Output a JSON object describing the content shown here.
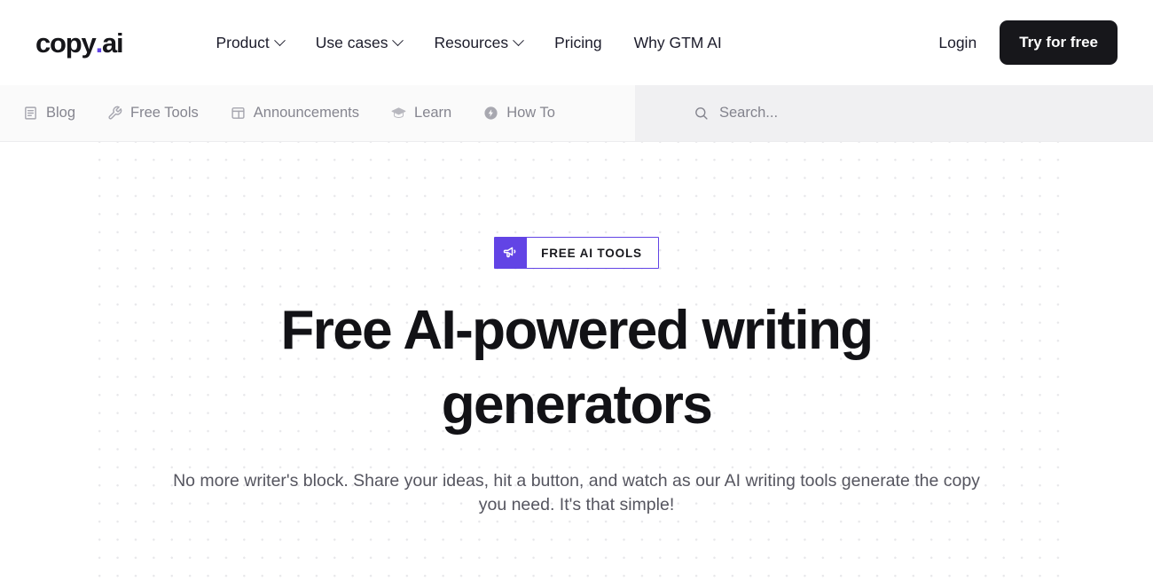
{
  "brand": {
    "name_main": "copy",
    "name_dot": ".",
    "name_suffix": "ai",
    "accent_color": "#6244e5"
  },
  "header": {
    "nav": [
      {
        "label": "Product",
        "has_chevron": true,
        "icon": "chevron-down-icon"
      },
      {
        "label": "Use cases",
        "has_chevron": true,
        "icon": "chevron-down-icon"
      },
      {
        "label": "Resources",
        "has_chevron": true,
        "icon": "chevron-down-icon"
      },
      {
        "label": "Pricing",
        "has_chevron": false,
        "icon": ""
      },
      {
        "label": "Why GTM AI",
        "has_chevron": false,
        "icon": ""
      }
    ],
    "login_label": "Login",
    "cta_label": "Try for free",
    "cta_bg": "#17171b"
  },
  "subnav": {
    "items": [
      {
        "label": "Blog",
        "icon": "book-icon"
      },
      {
        "label": "Free Tools",
        "icon": "tools-icon"
      },
      {
        "label": "Announcements",
        "icon": "layout-panel-icon"
      },
      {
        "label": "Learn",
        "icon": "graduation-cap-icon"
      },
      {
        "label": "How To",
        "icon": "zap-circle-icon"
      }
    ],
    "search": {
      "placeholder": "Search...",
      "icon": "search-icon"
    }
  },
  "hero": {
    "badge": {
      "label": "FREE AI TOOLS",
      "icon": "megaphone-icon",
      "accent": "#6244e5"
    },
    "heading": "Free AI-powered writing generators",
    "subtitle": "No more writer's block. Share your ideas, hit a button, and watch as our AI writing tools generate the copy you need. It's that simple!"
  }
}
